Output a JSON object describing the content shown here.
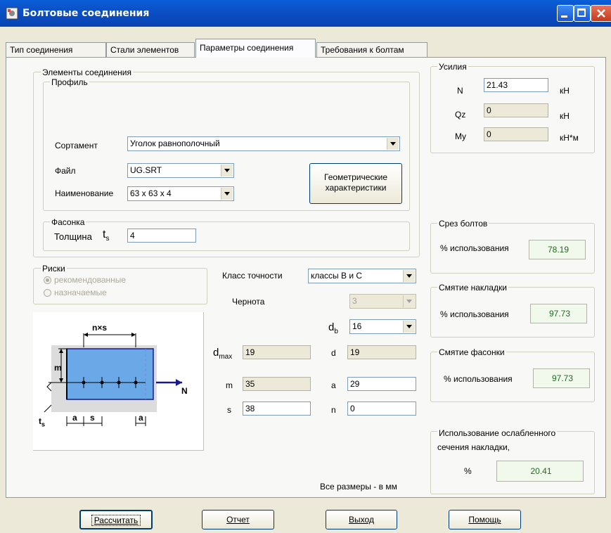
{
  "window": {
    "title": "Болтовые соединения"
  },
  "tabs": [
    {
      "label": "Тип соединения"
    },
    {
      "label": "Стали элементов"
    },
    {
      "label": "Параметры соединения"
    },
    {
      "label": "Требования к болтам"
    }
  ],
  "elements": {
    "group_title": "Элементы соединения",
    "profile_title": "Профиль",
    "sortament_label": "Сортамент",
    "sortament_value": "Уголок равнополочный",
    "file_label": "Файл",
    "file_value": "UG.SRT",
    "name_label": "Наименование",
    "name_value": "63 x 63 x 4",
    "geom_button": "Геометрические характеристики",
    "fasonka_title": "Фасонка",
    "thickness_label": "Толщина",
    "thickness_symbol": "t",
    "thickness_sub": "s",
    "thickness_value": "4"
  },
  "riski": {
    "title": "Риски",
    "opt1": "рекомендованные",
    "opt2": "назначаемые"
  },
  "bolts": {
    "class_label": "Класс точности",
    "class_value": "классы В и С",
    "chernota_label": "Чернота",
    "chernota_value": "3",
    "db_label": "d",
    "db_sub": "b",
    "db_value": "16",
    "dmax_label": "d",
    "dmax_sub": "max",
    "dmax_value": "19",
    "d_label": "d",
    "d_value": "19",
    "m_label": "m",
    "m_value": "35",
    "a_label": "a",
    "a_value": "29",
    "s_label": "s",
    "s_value": "38",
    "n_label": "n",
    "n_value": "0",
    "units_note": "Все размеры - в мм"
  },
  "diagram": {
    "nxs": "n×s",
    "m": "m",
    "N": "N",
    "ts": "t",
    "ts_sub": "s",
    "a1": "a",
    "s": "s",
    "a2": "a"
  },
  "forces": {
    "title": "Усилия",
    "N_label": "N",
    "N_value": "21.43",
    "N_unit": "кН",
    "Qz_label": "Qz",
    "Qz_value": "0",
    "Qz_unit": "кН",
    "My_label": "My",
    "My_value": "0",
    "My_unit": "кН*м"
  },
  "results": {
    "srez_title": "Срез болтов",
    "srez_label": "% использования",
    "srez_value": "78.19",
    "smyatie_nakl_title": "Смятие накладки",
    "smyatie_nakl_label": "% использования",
    "smyatie_nakl_value": "97.73",
    "smyatie_fas_title": "Смятие фасонки",
    "smyatie_fas_label": "% использования",
    "smyatie_fas_value": "97.73",
    "weak_title_1": "Использование ослабленного",
    "weak_title_2": "сечения накладки,",
    "weak_label": "%",
    "weak_value": "20.41"
  },
  "buttons": {
    "calc": "Рассчитать",
    "report": "Отчет",
    "exit": "Выход",
    "help": "Помощь"
  }
}
